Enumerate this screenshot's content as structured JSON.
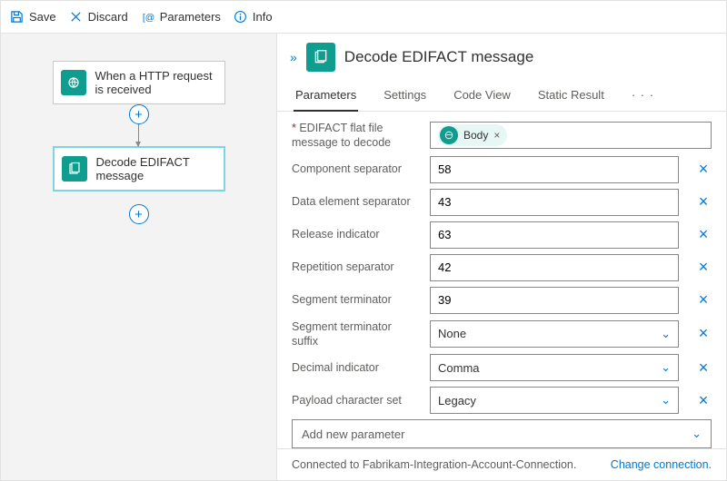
{
  "toolbar": {
    "save": "Save",
    "discard": "Discard",
    "parameters": "Parameters",
    "info": "Info"
  },
  "canvas": {
    "trigger": {
      "label": "When a HTTP request is received"
    },
    "action1": {
      "label": "Decode EDIFACT message"
    }
  },
  "panel": {
    "title": "Decode EDIFACT message",
    "tabs": {
      "parameters": "Parameters",
      "settings": "Settings",
      "codeview": "Code View",
      "static": "Static Result",
      "more": "· · ·"
    },
    "fields": {
      "flatfile": {
        "label": "EDIFACT flat file message to decode",
        "token": "Body"
      },
      "component": {
        "label": "Component separator",
        "value": "58"
      },
      "dataelem": {
        "label": "Data element separator",
        "value": "43"
      },
      "release": {
        "label": "Release indicator",
        "value": "63"
      },
      "repetition": {
        "label": "Repetition separator",
        "value": "42"
      },
      "segterm": {
        "label": "Segment terminator",
        "value": "39"
      },
      "segsuffix": {
        "label": "Segment terminator suffix",
        "value": "None"
      },
      "decimal": {
        "label": "Decimal indicator",
        "value": "Comma"
      },
      "payload": {
        "label": "Payload character set",
        "value": "Legacy"
      }
    },
    "addparam": "Add new parameter",
    "footer": {
      "connected": "Connected to Fabrikam-Integration-Account-Connection.",
      "change": "Change connection."
    }
  }
}
